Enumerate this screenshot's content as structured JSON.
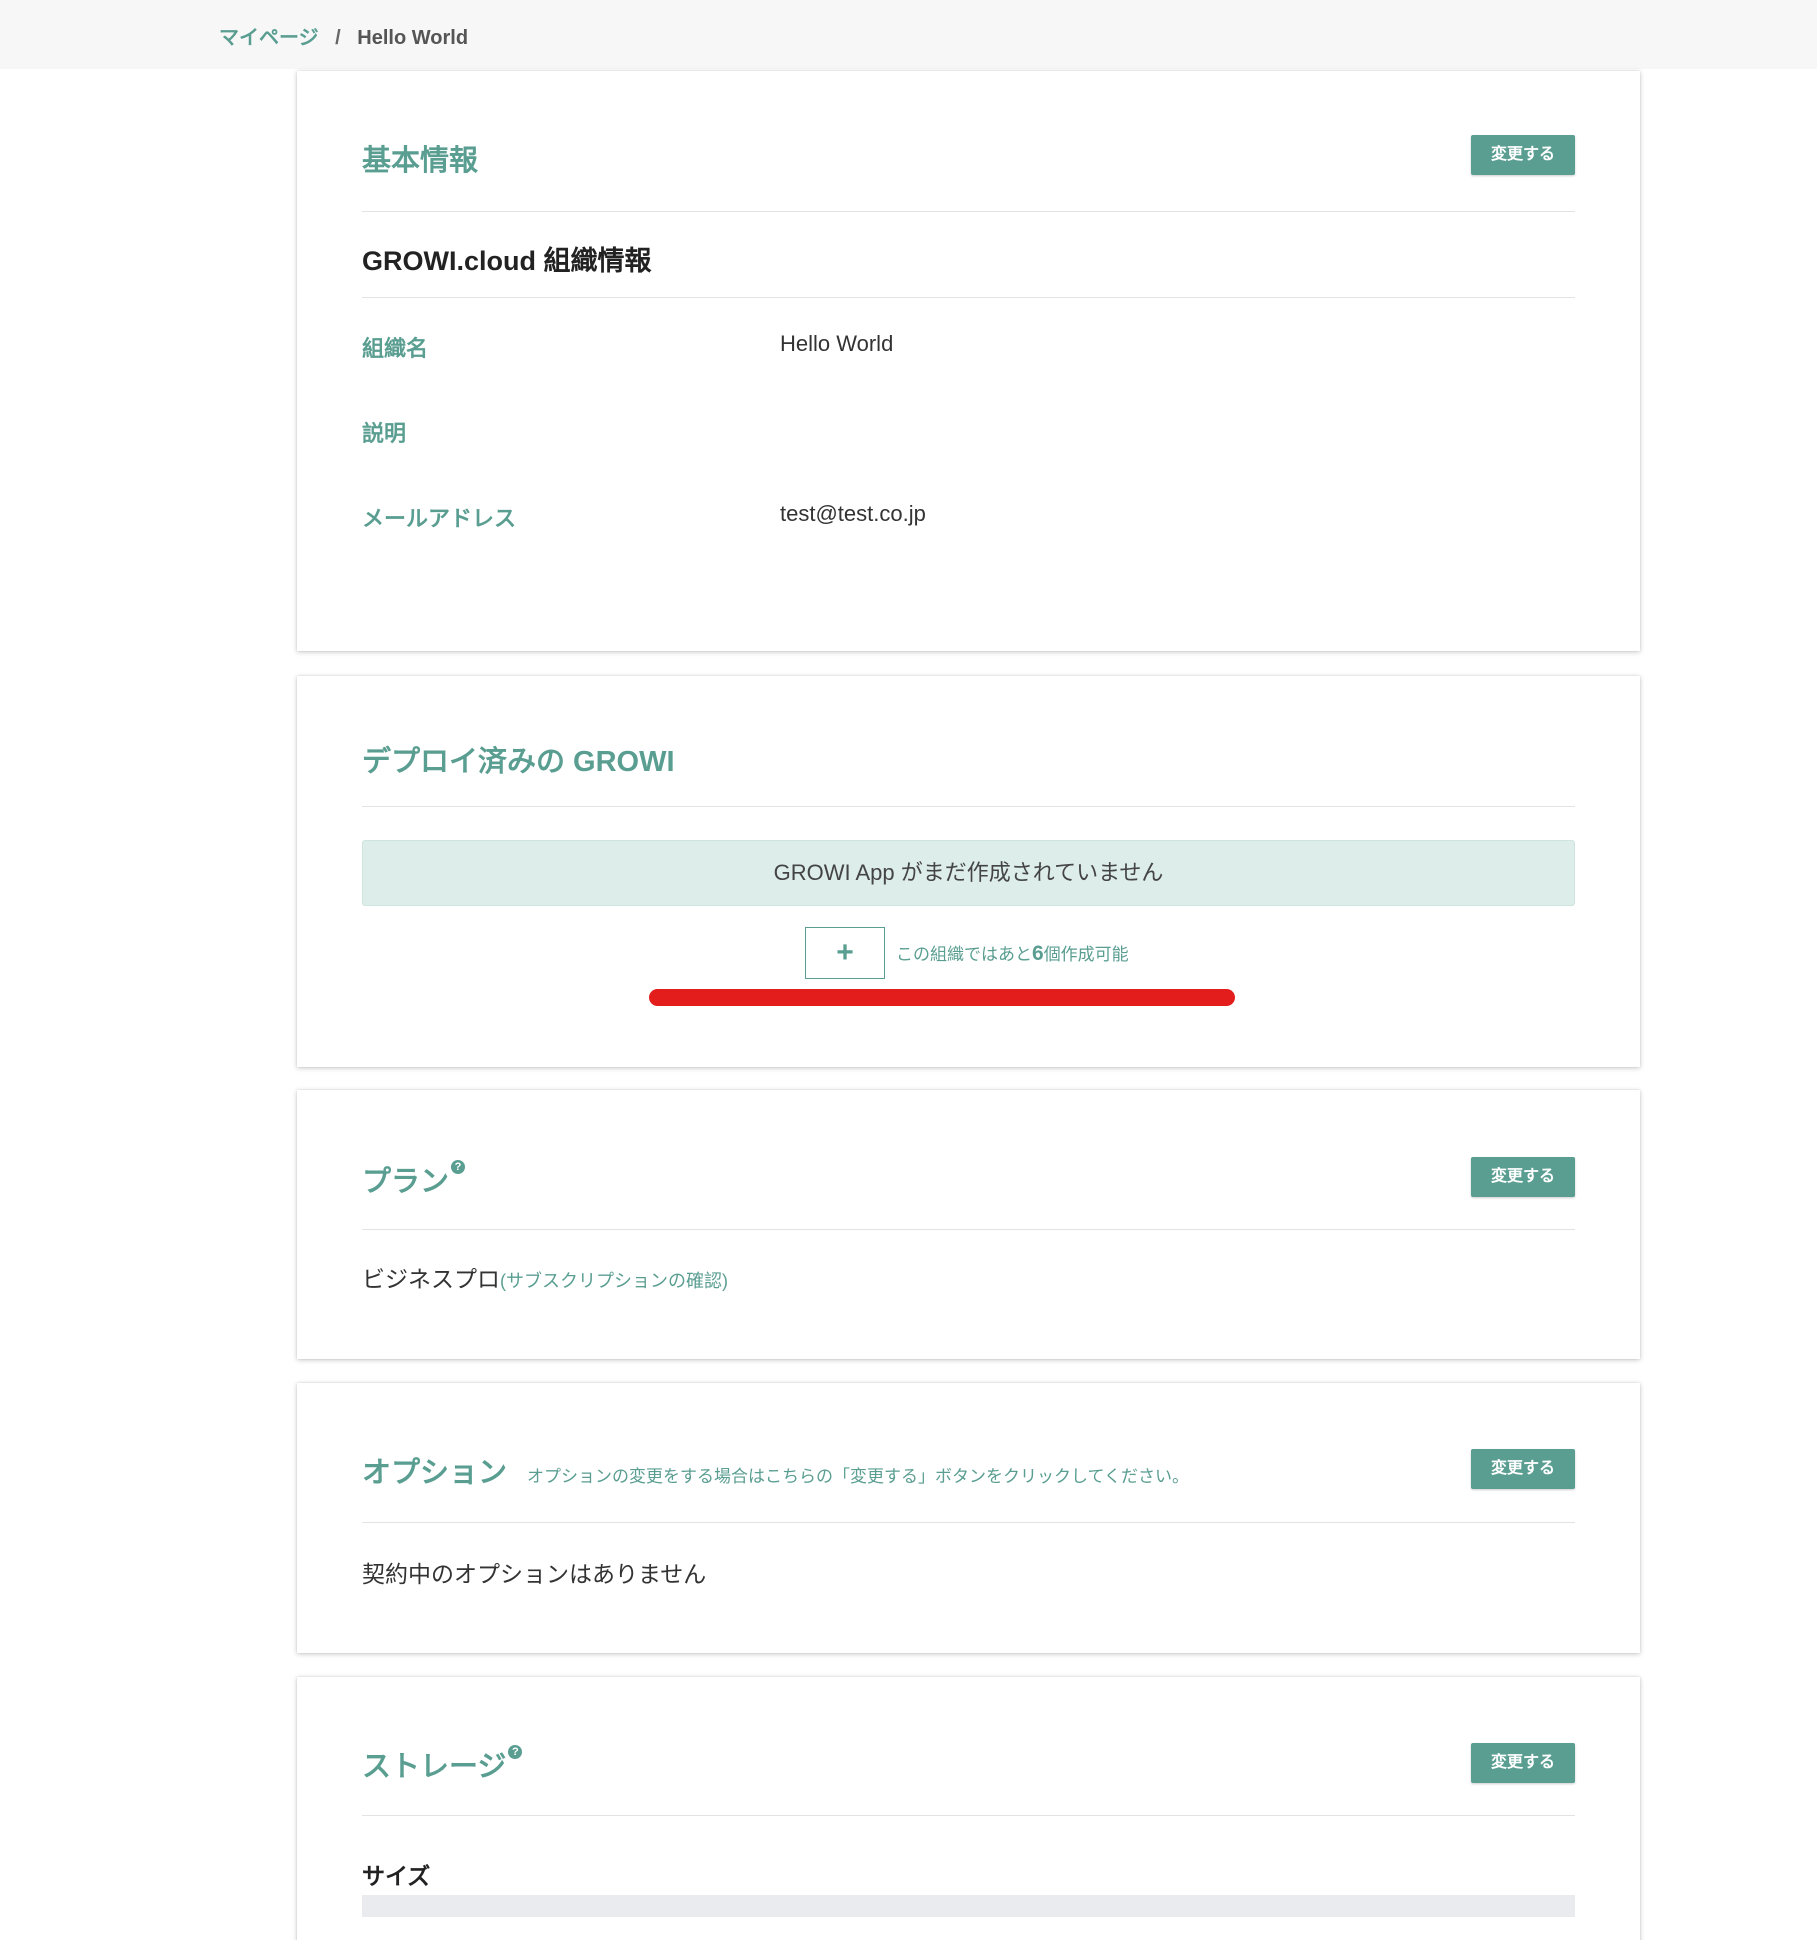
{
  "breadcrumb": {
    "root": "マイページ",
    "separator": "/",
    "current": "Hello World"
  },
  "basic_info": {
    "title": "基本情報",
    "change_button": "変更する",
    "org_heading": "GROWI.cloud 組織情報",
    "rows": [
      {
        "label": "組織名",
        "value": "Hello World"
      },
      {
        "label": "説明",
        "value": ""
      },
      {
        "label": "メールアドレス",
        "value": "test@test.co.jp"
      }
    ]
  },
  "deployed": {
    "title": "デプロイ済みの GROWI",
    "empty_message": "GROWI App がまだ作成されていません",
    "add_button": "+",
    "remaining_prefix": "この組織ではあと",
    "remaining_count": "6",
    "remaining_suffix": "個作成可能"
  },
  "plan": {
    "title": "プラン",
    "help_icon": "?",
    "change_button": "変更する",
    "value": "ビジネスプロ",
    "subscription_link": "(サブスクリプションの確認)"
  },
  "option": {
    "title": "オプション",
    "note": "オプションの変更をする場合はこちらの「変更する」ボタンをクリックしてください。",
    "change_button": "変更する",
    "value": "契約中のオプションはありません"
  },
  "storage": {
    "title": "ストレージ",
    "help_icon": "?",
    "change_button": "変更する",
    "size_label": "サイズ",
    "usage_fraction": 0
  },
  "colors": {
    "accent": "#5a9e91",
    "annotation_red": "#e31c1c",
    "banner_bg": "#ddedea"
  }
}
